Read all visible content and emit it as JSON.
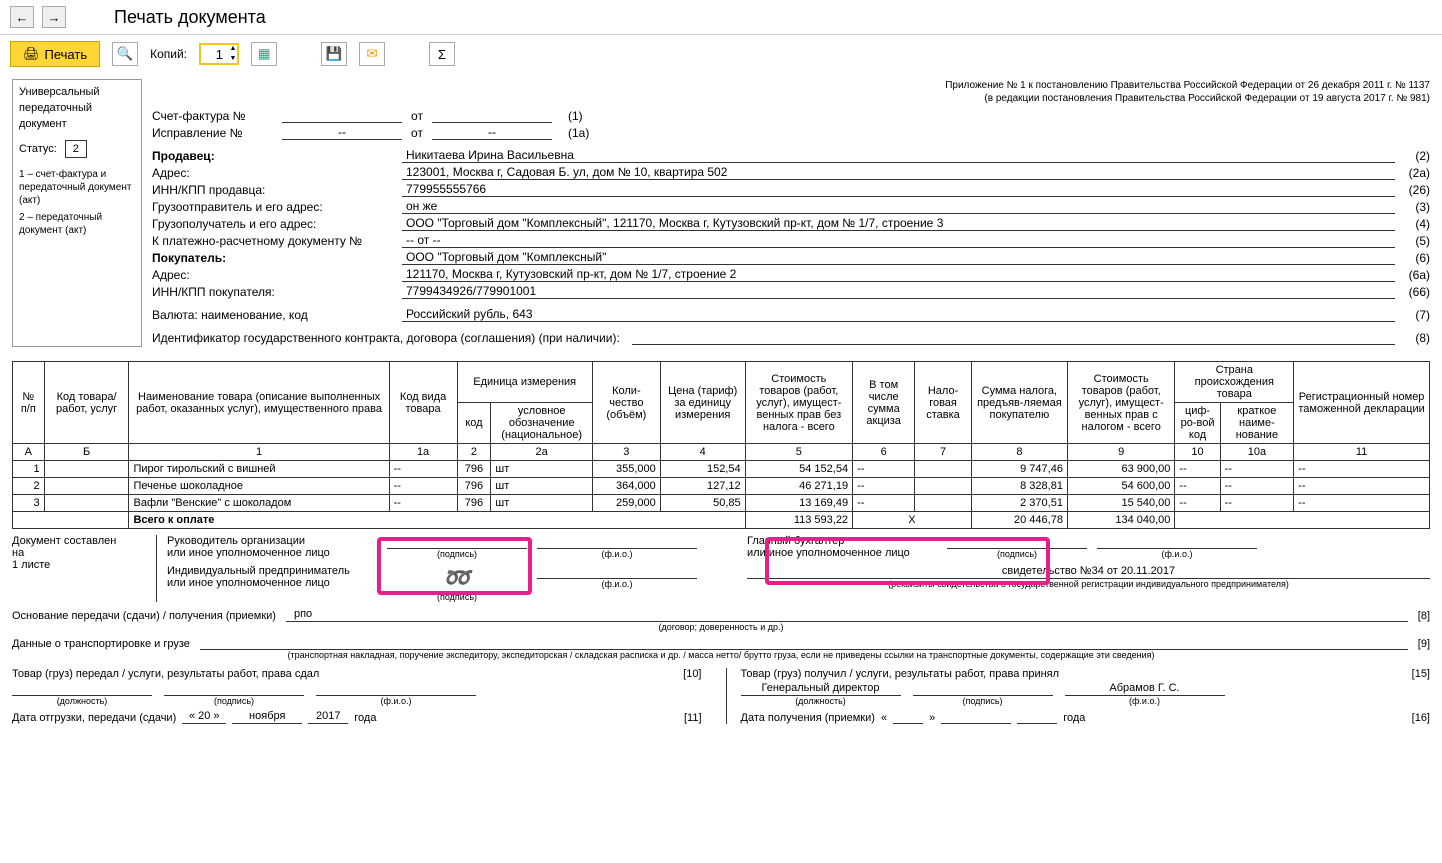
{
  "toolbar": {
    "title": "Печать документа",
    "print": "Печать",
    "copies_label": "Копий:",
    "copies_value": "1"
  },
  "left": {
    "l1": "Универсальный",
    "l2": "передаточный",
    "l3": "документ",
    "status_label": "Статус:",
    "status_value": "2",
    "note1": "1 – счет-фактура и передаточный документ (акт)",
    "note2": "2 – передаточный документ (акт)"
  },
  "hdr": {
    "r1": "Приложение № 1 к постановлению Правительства Российской Федерации от 26 декабря 2011 г. № 1137",
    "r2": "(в редакции постановления Правительства Российской Федерации от 19 августа 2017 г. № 981)"
  },
  "info": {
    "sf_label": "Счет-фактура №",
    "sf_val": "",
    "ot": "от",
    "sf_date": "",
    "sf_num": "(1)",
    "isp_label": "Исправление №",
    "isp_val": "--",
    "isp_date": "--",
    "isp_num": "(1а)",
    "seller": "Продавец:",
    "seller_val": "Никитаева Ирина Васильевна",
    "n2": "(2)",
    "addr": "Адрес:",
    "addr_val": "123001, Москва г, Садовая Б. ул, дом № 10, квартира 502",
    "n2a": "(2а)",
    "inn": "ИНН/КПП продавца:",
    "inn_val": "779955555766",
    "n26": "(26)",
    "ship": "Грузоотправитель и его адрес:",
    "ship_val": "он же",
    "n3": "(3)",
    "cons": "Грузополучатель и его адрес:",
    "cons_val": "ООО \"Торговый дом \"Комплексный\", 121170, Москва г, Кутузовский пр-кт, дом № 1/7, строение 3",
    "n4": "(4)",
    "pay": "К платежно-расчетному документу №",
    "pay_val": "-- от --",
    "n5": "(5)",
    "buyer": "Покупатель:",
    "buyer_val": "ООО \"Торговый дом \"Комплексный\"",
    "n6": "(6)",
    "baddr": "Адрес:",
    "baddr_val": "121170, Москва г, Кутузовский пр-кт, дом № 1/7, строение 2",
    "n6a": "(6а)",
    "binn": "ИНН/КПП покупателя:",
    "binn_val": "7799434926/779901001",
    "n66": "(66)",
    "cur": "Валюта: наименование, код",
    "cur_val": "Российский рубль, 643",
    "n7": "(7)",
    "gos": "Идентификатор государственного контракта, договора (соглашения) (при наличии):",
    "gos_val": "",
    "n8": "(8)"
  },
  "th": {
    "c1": "№ п/п",
    "c2": "Код товара/ работ, услуг",
    "c3": "Наименование товара (описание выполненных работ, оказанных услуг), имущественного права",
    "c4": "Код вида товара",
    "c5": "Единица измерения",
    "c5a": "код",
    "c5b": "условное обозначение (национальное)",
    "c6": "Коли-чество (объём)",
    "c7": "Цена (тариф) за единицу измерения",
    "c8": "Стоимость товаров (работ, услуг), имущест-венных прав без налога - всего",
    "c9": "В том числе сумма акциза",
    "c10": "Нало-говая ставка",
    "c11": "Сумма налога, предъяв-ляемая покупателю",
    "c12": "Стоимость товаров (работ, услуг), имущест-венных прав с налогом - всего",
    "c13": "Страна происхождения товара",
    "c13a": "циф-ро-вой код",
    "c13b": "краткое наиме-нование",
    "c14": "Регистрационный номер таможенной декларации",
    "hA": "А",
    "hB": "Б",
    "h1": "1",
    "h1a": "1а",
    "h2": "2",
    "h2a": "2а",
    "h3": "3",
    "h4": "4",
    "h5": "5",
    "h6": "6",
    "h7": "7",
    "h8": "8",
    "h9": "9",
    "h10": "10",
    "h10a": "10а",
    "h11": "11"
  },
  "rows": [
    {
      "n": "1",
      "name": "Пирог тирольский с вишней",
      "kvt": "--",
      "kod": "796",
      "ed": "шт",
      "qty": "355,000",
      "price": "152,54",
      "sumnovat": "54 152,54",
      "akciz": "--",
      "rate": "",
      "tax": "9 747,46",
      "sumvat": "63 900,00",
      "cc": "--",
      "cn": "--",
      "dec": "--"
    },
    {
      "n": "2",
      "name": "Печенье шоколадное",
      "kvt": "--",
      "kod": "796",
      "ed": "шт",
      "qty": "364,000",
      "price": "127,12",
      "sumnovat": "46 271,19",
      "akciz": "--",
      "rate": "",
      "tax": "8 328,81",
      "sumvat": "54 600,00",
      "cc": "--",
      "cn": "--",
      "dec": "--"
    },
    {
      "n": "3",
      "name": "Вафли \"Венские\" с шоколадом",
      "kvt": "--",
      "kod": "796",
      "ed": "шт",
      "qty": "259,000",
      "price": "50,85",
      "sumnovat": "13 169,49",
      "akciz": "--",
      "rate": "",
      "tax": "2 370,51",
      "sumvat": "15 540,00",
      "cc": "--",
      "cn": "--",
      "dec": "--"
    }
  ],
  "total": {
    "label": "Всего к оплате",
    "sumnovat": "113 593,22",
    "x": "X",
    "tax": "20 446,78",
    "sumvat": "134 040,00"
  },
  "sign": {
    "doc1": "Документ составлен",
    "doc2": "на",
    "doc3": "1 листе",
    "ruk": "Руководитель организации",
    "ruk2": "или иное уполномоченное лицо",
    "ip": "Индивидуальный предприниматель",
    "ip2": "или иное уполномоченное лицо",
    "gb": "Главный бухгалтер",
    "gb2": "или иное уполномоченное лицо",
    "podpis": "(подпись)",
    "fio": "(ф.и.о.)",
    "svid": "свидетельство №34 от 20.11.2017",
    "rekv": "(реквизиты свидетельства о государственной регистрации индивидуального предпринимателя)",
    "osn": "Основание передачи (сдачи) / получения (приемки)",
    "osn_val": "рпо",
    "osn_hint": "(договор; доверенность и др.)",
    "n8": "[8]",
    "tr": "Данные о транспортировке и грузе",
    "n9": "[9]",
    "tr_hint": "(транспортная накладная, поручение экспедитору, экспедиторская / складская расписка и др. / масса нетто/ брутто груза, если не приведены ссылки на транспортные документы, содержащие эти сведения)",
    "left_t": "Товар (груз) передал / услуги, результаты работ, права сдал",
    "n10": "[10]",
    "right_t": "Товар (груз) получил / услуги, результаты работ, права принял",
    "n15": "[15]",
    "right_pos": "Генеральный директор",
    "right_fio": "Абрамов Г. С.",
    "dolzh": "(должность)",
    "date_ship": "Дата отгрузки, передачи (сдачи)",
    "d1": "« 20 »",
    "d2": "ноября",
    "d3": "2017",
    "d4": "года",
    "n11": "[11]",
    "date_rec": "Дата получения (приемки)",
    "r1": "«",
    "r2": "»",
    "n16": "[16]"
  }
}
